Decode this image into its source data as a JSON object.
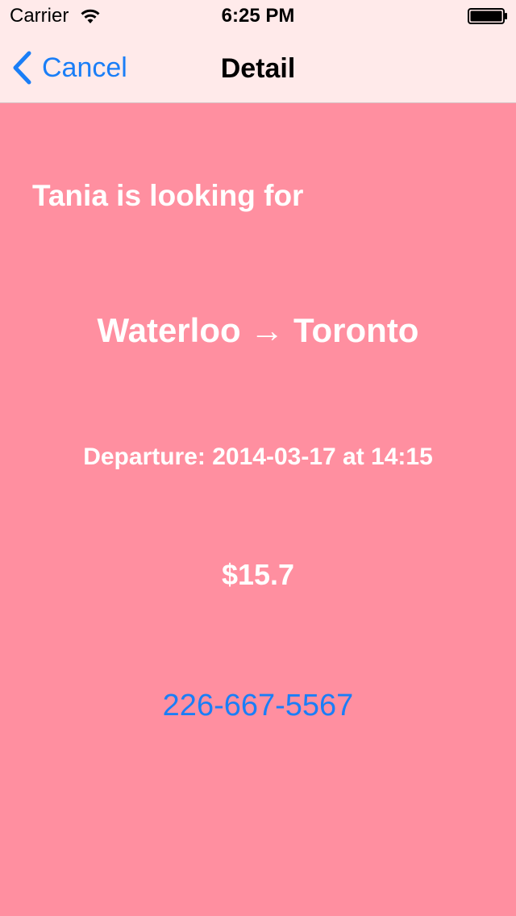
{
  "status_bar": {
    "carrier": "Carrier",
    "time": "6:25 PM"
  },
  "nav": {
    "back_label": "Cancel",
    "title": "Detail"
  },
  "detail": {
    "looking_for": "Tania is looking for",
    "route": "Waterloo → Toronto",
    "departure": "Departure: 2014-03-17 at 14:15",
    "price": "$15.7",
    "phone": "226-667-5567"
  },
  "colors": {
    "background": "#ff8fa0",
    "nav_background": "#ffeaea",
    "accent": "#1a7ef7",
    "text": "#ffffff"
  },
  "icons": {
    "wifi": "wifi-icon",
    "battery": "battery-icon",
    "back": "chevron-left-icon"
  }
}
